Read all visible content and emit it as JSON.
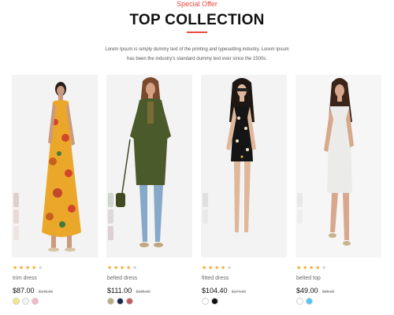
{
  "header": {
    "eyebrow": "Special Offer",
    "title": "TOP COLLECTION",
    "description": "Lorem Ipsum is simply dummy text of the printing and typesetting industry. Lorem Ipsum has been the industry's standard dummy text ever since the 1500s."
  },
  "colors": {
    "accent": "#e74c3c",
    "star": "#f5a623",
    "star_off": "#cfcfcf"
  },
  "products": [
    {
      "rating": 4,
      "name": "trim dress",
      "price": "$87.00",
      "old_price": "$145.00",
      "swatches": [
        "#f2ea7c",
        "#f5f5f5",
        "#f7b6c6"
      ]
    },
    {
      "rating": 4,
      "name": "belted dress",
      "price": "$111.00",
      "old_price": "$185.00",
      "swatches": [
        "#b6ad84",
        "#1b2749",
        "#c15a63"
      ]
    },
    {
      "rating": 4,
      "name": "fitted dress",
      "price": "$104.40",
      "old_price": "$174.00",
      "swatches": [
        "#ffffff",
        "#111111"
      ]
    },
    {
      "rating": 4,
      "name": "belted top",
      "price": "$49.00",
      "old_price": "$98.00",
      "swatches": [
        "#ffffff",
        "#53c6f0"
      ]
    }
  ]
}
